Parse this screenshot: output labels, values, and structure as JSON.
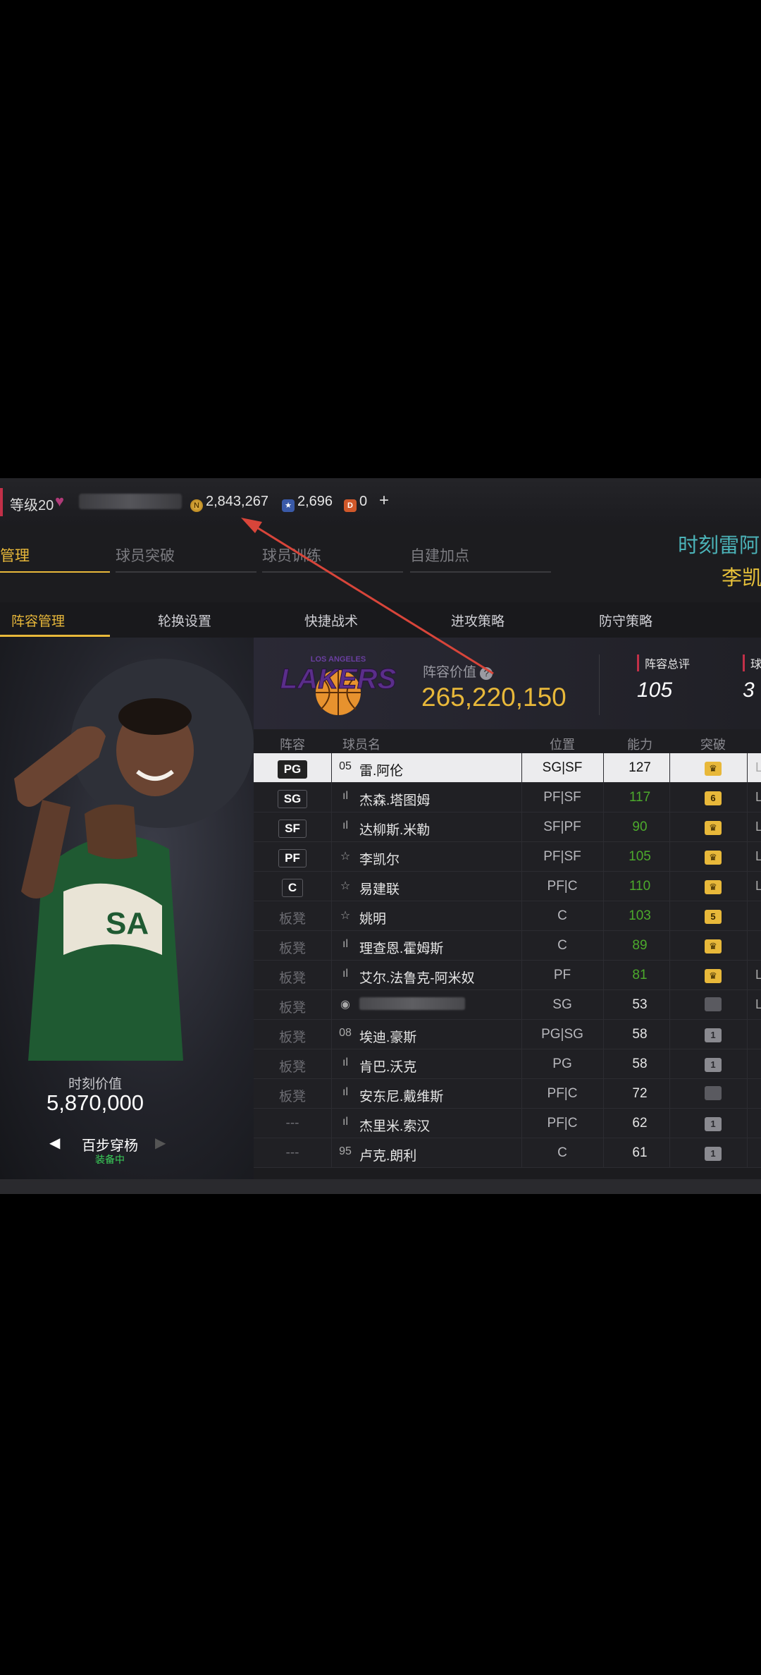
{
  "topbar": {
    "level": "等级20",
    "username": "",
    "coins": "2,843,267",
    "stars": "2,696",
    "points": "0",
    "plus_label": "+"
  },
  "tabs": [
    {
      "label": "管理",
      "active": true
    },
    {
      "label": "球员突破",
      "active": false
    },
    {
      "label": "球员训练",
      "active": false
    },
    {
      "label": "自建加点",
      "active": false
    }
  ],
  "event": {
    "title": "时刻雷阿",
    "subtitle": "李凯"
  },
  "subtabs": [
    {
      "label": "阵容管理",
      "active": true
    },
    {
      "label": "轮换设置",
      "active": false
    },
    {
      "label": "快捷战术",
      "active": false
    },
    {
      "label": "进攻策略",
      "active": false
    },
    {
      "label": "防守策略",
      "active": false
    }
  ],
  "hero": {
    "value_label": "时刻价值",
    "value": "5,870,000",
    "name": "百步穿杨",
    "status": "装备中",
    "prev_icon": "◀",
    "next_icon": "▶"
  },
  "team": {
    "logo_text": "LAKERS",
    "logo_top": "LOS ANGELES",
    "value_label": "阵容价值",
    "value": "265,220,150",
    "rating_label": "阵容总评",
    "rating": "105",
    "extra_label": "球",
    "extra_value": "3"
  },
  "table": {
    "headers": [
      "阵容",
      "球员名",
      "位置",
      "能力",
      "突破"
    ],
    "rows": [
      {
        "pos": "PG",
        "starter": true,
        "icon": "05",
        "name": "雷.阿伦",
        "position": "SG|SF",
        "ability": "127",
        "green": false,
        "brk": "♛",
        "brk_style": "gold",
        "tail": "L"
      },
      {
        "pos": "SG",
        "starter": true,
        "icon": "ıl",
        "name": "杰森.塔图姆",
        "position": "PF|SF",
        "ability": "117",
        "green": true,
        "brk": "6",
        "brk_style": "gold",
        "tail": "L"
      },
      {
        "pos": "SF",
        "starter": true,
        "icon": "ıl",
        "name": "达柳斯.米勒",
        "position": "SF|PF",
        "ability": "90",
        "green": true,
        "brk": "♛",
        "brk_style": "gold",
        "tail": "L"
      },
      {
        "pos": "PF",
        "starter": true,
        "icon": "☆",
        "name": "李凯尔",
        "position": "PF|SF",
        "ability": "105",
        "green": true,
        "brk": "♛",
        "brk_style": "gold",
        "tail": "L"
      },
      {
        "pos": "C",
        "starter": true,
        "icon": "☆",
        "name": "易建联",
        "position": "PF|C",
        "ability": "110",
        "green": true,
        "brk": "♛",
        "brk_style": "gold",
        "tail": "L"
      },
      {
        "pos": "板凳",
        "starter": false,
        "icon": "☆",
        "name": "姚明",
        "position": "C",
        "ability": "103",
        "green": true,
        "brk": "5",
        "brk_style": "gold",
        "tail": ""
      },
      {
        "pos": "板凳",
        "starter": false,
        "icon": "ıl",
        "name": "理查恩.霍姆斯",
        "position": "C",
        "ability": "89",
        "green": true,
        "brk": "♛",
        "brk_style": "gold",
        "tail": ""
      },
      {
        "pos": "板凳",
        "starter": false,
        "icon": "ıl",
        "name": "艾尔.法鲁克-阿米奴",
        "position": "PF",
        "ability": "81",
        "green": true,
        "brk": "♛",
        "brk_style": "gold",
        "tail": "L"
      },
      {
        "pos": "板凳",
        "starter": false,
        "icon": "◉",
        "name": "",
        "position": "SG",
        "ability": "53",
        "green": false,
        "brk": "",
        "brk_style": "dark",
        "tail": "L"
      },
      {
        "pos": "板凳",
        "starter": false,
        "icon": "08",
        "name": "埃迪.豪斯",
        "position": "PG|SG",
        "ability": "58",
        "green": false,
        "brk": "1",
        "brk_style": "gray",
        "tail": ""
      },
      {
        "pos": "板凳",
        "starter": false,
        "icon": "ıl",
        "name": "肯巴.沃克",
        "position": "PG",
        "ability": "58",
        "green": false,
        "brk": "1",
        "brk_style": "gray",
        "tail": ""
      },
      {
        "pos": "板凳",
        "starter": false,
        "icon": "ıl",
        "name": "安东尼.戴维斯",
        "position": "PF|C",
        "ability": "72",
        "green": false,
        "brk": "",
        "brk_style": "dark",
        "tail": ""
      },
      {
        "pos": "---",
        "starter": false,
        "icon": "ıl",
        "name": "杰里米.索汉",
        "position": "PF|C",
        "ability": "62",
        "green": false,
        "brk": "1",
        "brk_style": "gray",
        "tail": ""
      },
      {
        "pos": "---",
        "starter": false,
        "icon": "95",
        "name": "卢克.朗利",
        "position": "C",
        "ability": "61",
        "green": false,
        "brk": "1",
        "brk_style": "gray",
        "tail": ""
      }
    ]
  },
  "colors": {
    "accent": "#e8b83a",
    "green": "#4caa2c",
    "teal": "#4bb3b8",
    "red": "#c23048",
    "arrow": "#d8453a"
  }
}
